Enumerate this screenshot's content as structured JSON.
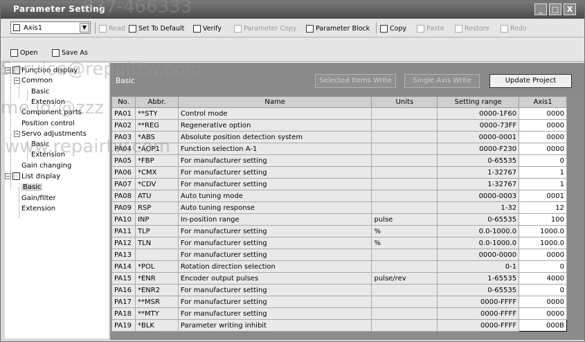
{
  "window": {
    "title": "Parameter Setting",
    "buttons": {
      "minimize": "_",
      "maximize": "□",
      "close": "X"
    }
  },
  "toolbar": {
    "axis_select": "Axis1",
    "read": "Read",
    "set_to_default": "Set To Default",
    "verify": "Verify",
    "parameter_copy": "Parameter Copy",
    "parameter_block": "Parameter Block",
    "copy": "Copy",
    "paste": "Paste",
    "restore": "Restore",
    "redo": "Redo",
    "open": "Open",
    "save_as": "Save As"
  },
  "watermarks": [
    "837-466333",
    "Service@repairtw.com",
    "me id:@zzz",
    "www.repairtw.com"
  ],
  "tree": {
    "function_display": "Function display",
    "common": "Common",
    "basic": "Basic",
    "extension": "Extension",
    "component_parts": "Component parts",
    "position_control": "Position control",
    "servo_adjustments": "Servo adjustments",
    "servo_basic": "Basic",
    "servo_extension": "Extension",
    "gain_changing": "Gain changing",
    "list_display": "List display",
    "list_basic": "Basic",
    "gain_filter": "Gain/filter",
    "list_extension": "Extension"
  },
  "panel": {
    "title": "Basic",
    "selected_items_write": "Selected Items Write",
    "single_axis_write": "Single Axis Write",
    "update_project": "Update Project"
  },
  "table": {
    "headers": {
      "no": "No.",
      "abbr": "Abbr.",
      "name": "Name",
      "units": "Units",
      "range": "Setting range",
      "axis": "Axis1"
    },
    "rows": [
      {
        "no": "PA01",
        "abbr": "**STY",
        "name": "Control mode",
        "units": "",
        "range": "0000-1F60",
        "value": "0000"
      },
      {
        "no": "PA02",
        "abbr": "**REG",
        "name": "Regenerative option",
        "units": "",
        "range": "0000-73FF",
        "value": "0000"
      },
      {
        "no": "PA03",
        "abbr": "*ABS",
        "name": "Absolute position detection system",
        "units": "",
        "range": "0000-0001",
        "value": "0000"
      },
      {
        "no": "PA04",
        "abbr": "*AOP1",
        "name": "Function selection A-1",
        "units": "",
        "range": "0000-F230",
        "value": "0000"
      },
      {
        "no": "PA05",
        "abbr": "*FBP",
        "name": "For manufacturer setting",
        "units": "",
        "range": "0-65535",
        "value": "0"
      },
      {
        "no": "PA06",
        "abbr": "*CMX",
        "name": "For manufacturer setting",
        "units": "",
        "range": "1-32767",
        "value": "1"
      },
      {
        "no": "PA07",
        "abbr": "*CDV",
        "name": "For manufacturer setting",
        "units": "",
        "range": "1-32767",
        "value": "1"
      },
      {
        "no": "PA08",
        "abbr": "ATU",
        "name": "Auto tuning mode",
        "units": "",
        "range": "0000-0003",
        "value": "0001"
      },
      {
        "no": "PA09",
        "abbr": "RSP",
        "name": "Auto tuning response",
        "units": "",
        "range": "1-32",
        "value": "12"
      },
      {
        "no": "PA10",
        "abbr": "INP",
        "name": "In-position range",
        "units": "pulse",
        "range": "0-65535",
        "value": "100"
      },
      {
        "no": "PA11",
        "abbr": "TLP",
        "name": "For manufacturer setting",
        "units": "%",
        "range": "0.0-1000.0",
        "value": "1000.0"
      },
      {
        "no": "PA12",
        "abbr": "TLN",
        "name": "For manufacturer setting",
        "units": "%",
        "range": "0.0-1000.0",
        "value": "1000.0"
      },
      {
        "no": "PA13",
        "abbr": "",
        "name": "For manufacturer setting",
        "units": "",
        "range": "0000-0000",
        "value": "0000"
      },
      {
        "no": "PA14",
        "abbr": "*POL",
        "name": "Rotation direction selection",
        "units": "",
        "range": "0-1",
        "value": "0"
      },
      {
        "no": "PA15",
        "abbr": "*ENR",
        "name": "Encoder output pulses",
        "units": "pulse/rev",
        "range": "1-65535",
        "value": "4000"
      },
      {
        "no": "PA16",
        "abbr": "*ENR2",
        "name": "For manufacturer setting",
        "units": "",
        "range": "0-65535",
        "value": "0"
      },
      {
        "no": "PA17",
        "abbr": "**MSR",
        "name": "For manufacturer setting",
        "units": "",
        "range": "0000-FFFF",
        "value": "0000"
      },
      {
        "no": "PA18",
        "abbr": "**MTY",
        "name": "For manufacturer setting",
        "units": "",
        "range": "0000-FFFF",
        "value": "0000"
      },
      {
        "no": "PA19",
        "abbr": "*BLK",
        "name": "Parameter writing inhibit",
        "units": "",
        "range": "0000-FFFF",
        "value": "000B"
      }
    ]
  }
}
